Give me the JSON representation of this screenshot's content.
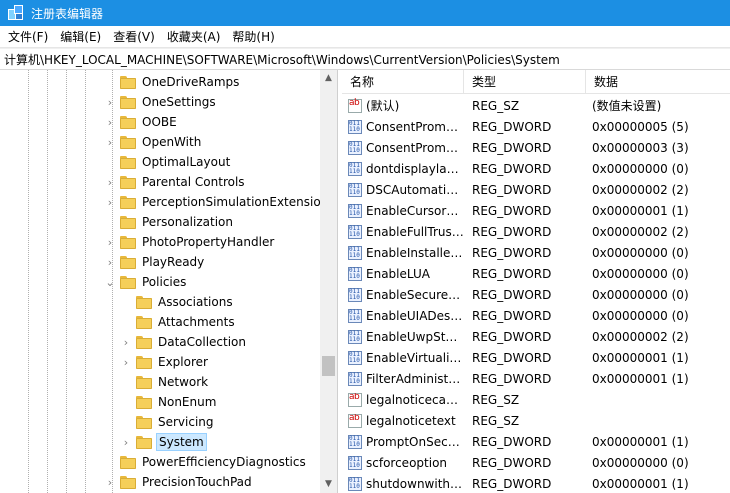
{
  "window": {
    "title": "注册表编辑器"
  },
  "menu": [
    "文件(F)",
    "编辑(E)",
    "查看(V)",
    "收藏夹(A)",
    "帮助(H)"
  ],
  "address": "计算机\\HKEY_LOCAL_MACHINE\\SOFTWARE\\Microsoft\\Windows\\CurrentVersion\\Policies\\System",
  "tree": [
    {
      "label": "OneDriveRamps",
      "expander": "",
      "selected": false
    },
    {
      "label": "OneSettings",
      "expander": "›",
      "selected": false
    },
    {
      "label": "OOBE",
      "expander": "›",
      "selected": false
    },
    {
      "label": "OpenWith",
      "expander": "›",
      "selected": false
    },
    {
      "label": "OptimalLayout",
      "expander": "",
      "selected": false
    },
    {
      "label": "Parental Controls",
      "expander": "›",
      "selected": false
    },
    {
      "label": "PerceptionSimulationExtensions",
      "expander": "›",
      "selected": false
    },
    {
      "label": "Personalization",
      "expander": "",
      "selected": false
    },
    {
      "label": "PhotoPropertyHandler",
      "expander": "›",
      "selected": false
    },
    {
      "label": "PlayReady",
      "expander": "›",
      "selected": false
    },
    {
      "label": "Policies",
      "expander": "⌄",
      "selected": false
    },
    {
      "label": "Associations",
      "expander": "",
      "selected": false
    },
    {
      "label": "Attachments",
      "expander": "",
      "selected": false
    },
    {
      "label": "DataCollection",
      "expander": "›",
      "selected": false
    },
    {
      "label": "Explorer",
      "expander": "›",
      "selected": false
    },
    {
      "label": "Network",
      "expander": "",
      "selected": false
    },
    {
      "label": "NonEnum",
      "expander": "",
      "selected": false
    },
    {
      "label": "Servicing",
      "expander": "",
      "selected": false
    },
    {
      "label": "System",
      "expander": "›",
      "selected": true
    },
    {
      "label": "PowerEfficiencyDiagnostics",
      "expander": "",
      "selected": false
    },
    {
      "label": "PrecisionTouchPad",
      "expander": "›",
      "selected": false
    }
  ],
  "columns": {
    "name": "名称",
    "type": "类型",
    "data": "数据"
  },
  "values": [
    {
      "icon": "string-value-icon",
      "name": "(默认)",
      "type": "REG_SZ",
      "data": "(数值未设置)"
    },
    {
      "icon": "dword-value-icon",
      "name": "ConsentPromp…",
      "type": "REG_DWORD",
      "data": "0x00000005 (5)"
    },
    {
      "icon": "dword-value-icon",
      "name": "ConsentPromp…",
      "type": "REG_DWORD",
      "data": "0x00000003 (3)"
    },
    {
      "icon": "dword-value-icon",
      "name": "dontdisplaylas…",
      "type": "REG_DWORD",
      "data": "0x00000000 (0)"
    },
    {
      "icon": "dword-value-icon",
      "name": "DSCAutomatio…",
      "type": "REG_DWORD",
      "data": "0x00000002 (2)"
    },
    {
      "icon": "dword-value-icon",
      "name": "EnableCursorS…",
      "type": "REG_DWORD",
      "data": "0x00000001 (1)"
    },
    {
      "icon": "dword-value-icon",
      "name": "EnableFullTrust…",
      "type": "REG_DWORD",
      "data": "0x00000002 (2)"
    },
    {
      "icon": "dword-value-icon",
      "name": "EnableInstaller…",
      "type": "REG_DWORD",
      "data": "0x00000000 (0)"
    },
    {
      "icon": "dword-value-icon",
      "name": "EnableLUA",
      "type": "REG_DWORD",
      "data": "0x00000000 (0)"
    },
    {
      "icon": "dword-value-icon",
      "name": "EnableSecureU…",
      "type": "REG_DWORD",
      "data": "0x00000000 (0)"
    },
    {
      "icon": "dword-value-icon",
      "name": "EnableUIADes…",
      "type": "REG_DWORD",
      "data": "0x00000000 (0)"
    },
    {
      "icon": "dword-value-icon",
      "name": "EnableUwpSta…",
      "type": "REG_DWORD",
      "data": "0x00000002 (2)"
    },
    {
      "icon": "dword-value-icon",
      "name": "EnableVirtualiz…",
      "type": "REG_DWORD",
      "data": "0x00000001 (1)"
    },
    {
      "icon": "dword-value-icon",
      "name": "FilterAdministr…",
      "type": "REG_DWORD",
      "data": "0x00000001 (1)"
    },
    {
      "icon": "string-value-icon",
      "name": "legalnoticecap…",
      "type": "REG_SZ",
      "data": ""
    },
    {
      "icon": "string-value-icon",
      "name": "legalnoticetext",
      "type": "REG_SZ",
      "data": ""
    },
    {
      "icon": "dword-value-icon",
      "name": "PromptOnSecu…",
      "type": "REG_DWORD",
      "data": "0x00000001 (1)"
    },
    {
      "icon": "dword-value-icon",
      "name": "scforceoption",
      "type": "REG_DWORD",
      "data": "0x00000000 (0)"
    },
    {
      "icon": "dword-value-icon",
      "name": "shutdownwitho…",
      "type": "REG_DWORD",
      "data": "0x00000001 (1)"
    }
  ],
  "scrollbar": {
    "up_arrow": "▲",
    "down_arrow": "▼"
  }
}
